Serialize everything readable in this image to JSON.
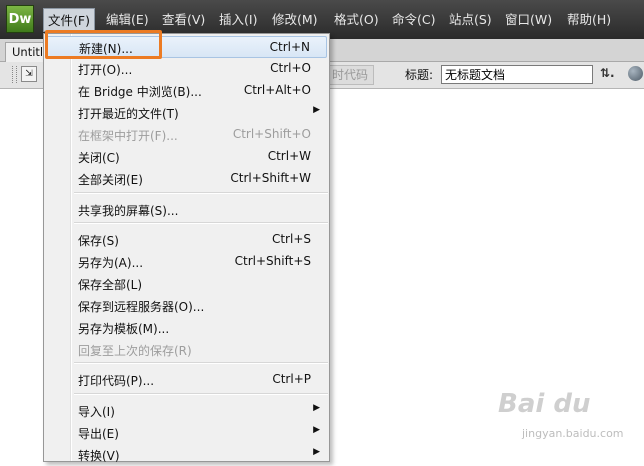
{
  "app": {
    "logo": "Dw"
  },
  "menubar": {
    "items": [
      "文件(F)",
      "编辑(E)",
      "查看(V)",
      "插入(I)",
      "修改(M)",
      "格式(O)",
      "命令(C)",
      "站点(S)",
      "窗口(W)",
      "帮助(H)"
    ]
  },
  "document": {
    "tab_label": "Untitl",
    "live_code_label": "时代码",
    "title_label": "标题:",
    "title_value": "无标题文档"
  },
  "file_menu": {
    "items": [
      {
        "label": "新建(N)...",
        "shortcut": "Ctrl+N",
        "enabled": true,
        "highlighted": true
      },
      {
        "label": "打开(O)...",
        "shortcut": "Ctrl+O",
        "enabled": true
      },
      {
        "label": "在 Bridge 中浏览(B)...",
        "shortcut": "Ctrl+Alt+O",
        "enabled": true
      },
      {
        "label": "打开最近的文件(T)",
        "shortcut": "",
        "enabled": true,
        "submenu": true
      },
      {
        "label": "在框架中打开(F)...",
        "shortcut": "Ctrl+Shift+O",
        "enabled": false
      },
      {
        "label": "关闭(C)",
        "shortcut": "Ctrl+W",
        "enabled": true
      },
      {
        "label": "全部关闭(E)",
        "shortcut": "Ctrl+Shift+W",
        "enabled": true
      },
      {
        "label": "共享我的屏幕(S)...",
        "shortcut": "",
        "enabled": true
      },
      {
        "label": "保存(S)",
        "shortcut": "Ctrl+S",
        "enabled": true
      },
      {
        "label": "另存为(A)...",
        "shortcut": "Ctrl+Shift+S",
        "enabled": true
      },
      {
        "label": "保存全部(L)",
        "shortcut": "",
        "enabled": true
      },
      {
        "label": "保存到远程服务器(O)...",
        "shortcut": "",
        "enabled": true
      },
      {
        "label": "另存为模板(M)...",
        "shortcut": "",
        "enabled": true
      },
      {
        "label": "回复至上次的保存(R)",
        "shortcut": "",
        "enabled": false
      },
      {
        "label": "打印代码(P)...",
        "shortcut": "Ctrl+P",
        "enabled": true
      },
      {
        "label": "导入(I)",
        "shortcut": "",
        "enabled": true,
        "submenu": true
      },
      {
        "label": "导出(E)",
        "shortcut": "",
        "enabled": true,
        "submenu": true
      },
      {
        "label": "转换(V)",
        "shortcut": "",
        "enabled": true,
        "submenu": true
      }
    ],
    "submenu_arrow": "▶"
  },
  "watermark": {
    "logo": "Bai du",
    "subtitle": "jingyan.baidu.com"
  },
  "colors": {
    "highlight_outline": "#ec7b23",
    "menubar_bg": "#3a3a3a"
  }
}
